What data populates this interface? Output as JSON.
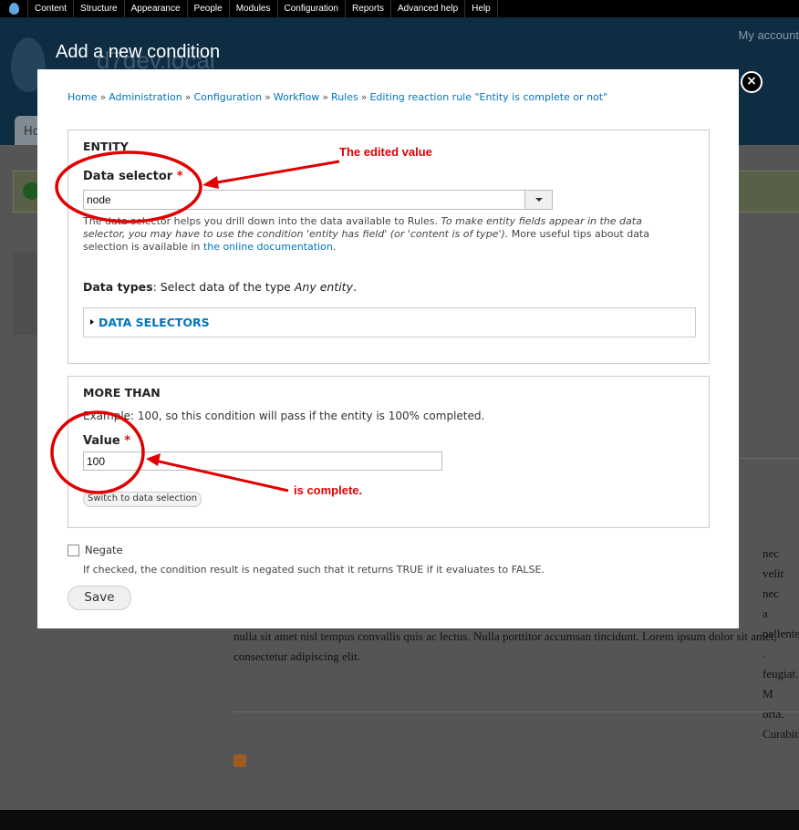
{
  "toolbar": {
    "items": [
      "Content",
      "Structure",
      "Appearance",
      "People",
      "Modules",
      "Configuration",
      "Reports",
      "Advanced help",
      "Help"
    ]
  },
  "header": {
    "site_name": "d7dev.local",
    "account_link": "My account",
    "home_tab": "Ho"
  },
  "background": {
    "lorem": "nulla sit amet nisl tempus convallis quis ac lectus. Nulla porttitor accumsan tincidunt. Lorem ipsum dolor sit amet, consectetur adipiscing elit.",
    "edge_lines": [
      "nec velit nec",
      "a pellentesque",
      ". feugiat. M",
      "orta. Curabitur"
    ]
  },
  "modal": {
    "title": "Add a new condition",
    "close_label": "×",
    "breadcrumb": [
      "Home",
      "Administration",
      "Configuration",
      "Workflow",
      "Rules",
      "Editing reaction rule \"Entity is complete or not\""
    ],
    "breadcrumb_sep": "»",
    "entity": {
      "legend": "ENTITY",
      "data_selector_label": "Data selector",
      "required_mark": "*",
      "data_selector_value": "node",
      "description_1": "The data selector helps you drill down into the data available to Rules.",
      "description_em": "To make entity fields appear in the data selector, you may have to use the condition 'entity has field' (or 'content is of type').",
      "description_2": "More useful tips about data selection is available in",
      "description_link": "the online documentation",
      "description_end": ".",
      "data_types_label": "Data types",
      "data_types_text": ": Select data of the type",
      "data_types_type": "Any entity",
      "data_types_end": ".",
      "data_selectors_toggle": "DATA SELECTORS"
    },
    "more_than": {
      "legend": "MORE THAN",
      "example": "Example: 100, so this condition will pass if the entity is 100% completed.",
      "value_label": "Value",
      "required_mark": "*",
      "value": "100",
      "switch_button": "Switch to data selection"
    },
    "negate": {
      "label": "Negate",
      "checked": false,
      "description": "If checked, the condition result is negated such that it returns TRUE if it evaluates to FALSE."
    },
    "save_button": "Save"
  },
  "annotations": {
    "edited_value": "The edited value",
    "is_complete": "is complete.",
    "color": "#e00000"
  }
}
